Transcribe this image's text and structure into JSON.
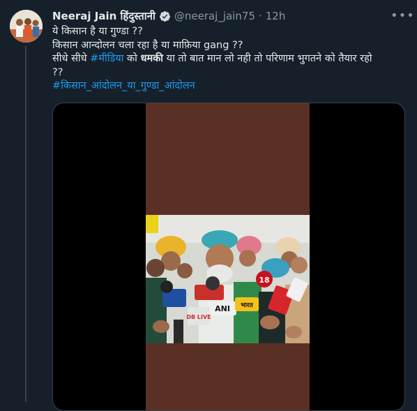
{
  "tweet": {
    "display_name": "Neeraj Jain हिंदुस्तानी",
    "handle": "@neeraj_jain75",
    "separator": "·",
    "time": "12h",
    "more_icon": "more-horizontal-icon",
    "verified_icon": "verified-badge-icon",
    "lines": {
      "l1": "ये किसान है या गुण्डा ??",
      "l2": "किसान आन्दोलन चला रहा है या माफ़िया gang ??",
      "l3_pre": "सीधे सीधे ",
      "l3_hashtag": "#मीडिया",
      "l3_mid": " को ",
      "l3_bold": "धमकी",
      "l3_post": " या तो बात मान लो नही तो परिणाम भुगतने को तैयार रहो",
      "l4": "??",
      "l5_hashtag": "#किसान_आंदोलन_या_गुण्डा_आंदोलन"
    },
    "mic_labels": {
      "m1": "ANI",
      "m2": "DB LIVE",
      "m3": "18",
      "m4": "भारत"
    },
    "colors": {
      "background": "#15202b",
      "text": "#e7e9ea",
      "secondary": "#8b98a5",
      "accent": "#1d9bf0",
      "video_bg": "#5a3024"
    }
  }
}
